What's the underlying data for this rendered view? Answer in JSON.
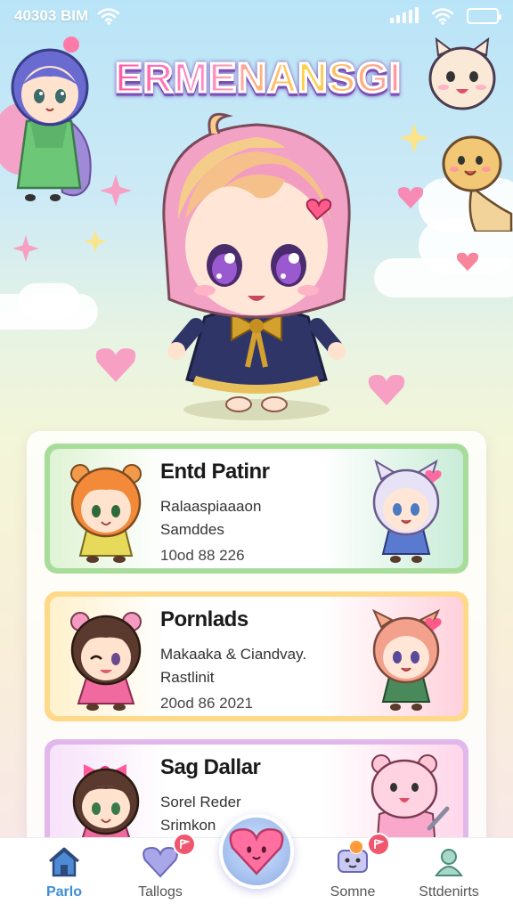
{
  "status_bar": {
    "time": "40303 BIM"
  },
  "app": {
    "title": "ERMENANSGI"
  },
  "cards": [
    {
      "title": "Entd Patinr",
      "line1": "Ralaaspiaaaon",
      "line2": "Samddes",
      "date": "10od 88 226",
      "border_color": "#a8dc9a",
      "left_tint": "#dff3d4",
      "right_tint": "#c9ecd8"
    },
    {
      "title": "Pornlads",
      "line1": "Makaaka & Ciandvay.",
      "line2": "Rastlinit",
      "date": "20od 86 2021",
      "border_color": "#ffd98a",
      "left_tint": "#fff1cc",
      "right_tint": "#ffd1dc"
    },
    {
      "title": "Sag Dallar",
      "line1": "Sorel Reder",
      "line2": "Srimkon",
      "date": "",
      "border_color": "#e2b8ec",
      "left_tint": "#f7e2fa",
      "right_tint": "#ffd6ea"
    }
  ],
  "nav": {
    "items": [
      {
        "label": "Parlo",
        "icon": "home-icon"
      },
      {
        "label": "Tallogs",
        "icon": "heart-icon"
      },
      {
        "label": "Somne",
        "icon": "chat-icon"
      },
      {
        "label": "Sttdenirts",
        "icon": "user-icon"
      }
    ],
    "center_icon": "heart-icon"
  },
  "colors": {
    "accent": "#ff6fae",
    "nav_active": "#3b8fd6",
    "badge": "#f0566e"
  }
}
